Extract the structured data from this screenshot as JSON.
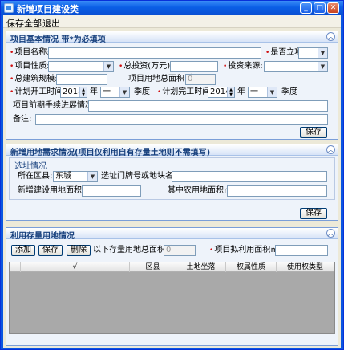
{
  "window": {
    "title": "新增项目建设类"
  },
  "menu": {
    "items": [
      "保存全部",
      "退出"
    ]
  },
  "basic": {
    "title": "项目基本情况 带*为必填项",
    "name_label": "项目名称:",
    "approved_label": "是否立项:",
    "nature_label": "项目性质:",
    "investment_label": "总投资(万元):",
    "source_label": "投资来源:",
    "scale_label": "总建筑规模:",
    "land_area_label": "项目用地总面积㎡:",
    "land_area_value": "0",
    "start_label": "计划开工时间:",
    "start_year": "2014",
    "start_quarter": "一",
    "end_label": "计划完工时间:",
    "end_year": "2014",
    "end_quarter": "一",
    "year_unit": "年",
    "quarter_unit": "季度",
    "progress_label": "项目前期手续进展情况:",
    "remarks_label": "备注:",
    "save": "保存"
  },
  "newland": {
    "title": "新增用地需求情况(项目仅利用自有存量土地则不需填写)",
    "site_title": "选址情况",
    "district_label": "所在区县:",
    "district_value": "东城",
    "plot_label": "选址门牌号或地块名称:",
    "new_area_label": "新增建设用地面积㎡:",
    "farmland_label": "其中农用地面积㎡:",
    "save": "保存"
  },
  "stock": {
    "title": "利用存量用地情况",
    "add": "添加",
    "save": "保存",
    "delete": "删除",
    "total_label": "以下存量用地总面积㎡:",
    "total_value": "0",
    "planned_label": "项目拟利用面积㎡:",
    "columns": [
      "√",
      "区县",
      "土地坐落",
      "权属性质",
      "使用权类型"
    ]
  }
}
